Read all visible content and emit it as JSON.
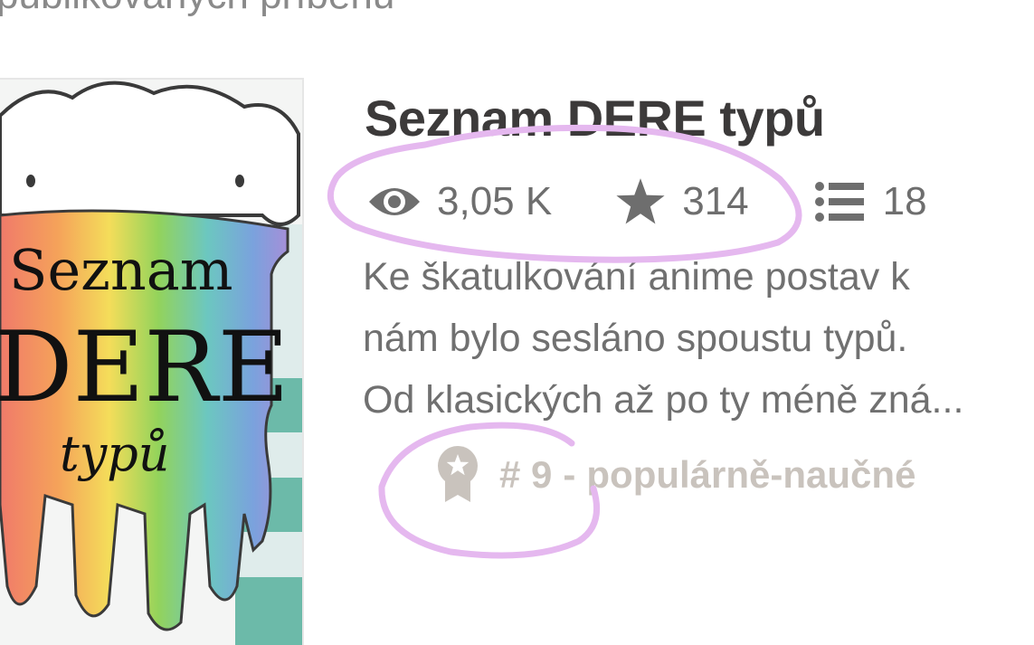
{
  "header": {
    "cut_text": "publikovaných příběhů"
  },
  "story": {
    "title": "Seznam DERE typů",
    "cover": {
      "line1": "Seznam",
      "line2": "DERE",
      "line3": "typů"
    },
    "stats": {
      "reads": "3,05 K",
      "votes": "314",
      "parts": "18",
      "reads_icon": "eye-icon",
      "votes_icon": "star-icon",
      "parts_icon": "list-icon"
    },
    "description": {
      "line1": "Ke škatulkování anime postav k",
      "line2": "nám bylo sesláno spoustu typů.",
      "line3": "Od klasických až po ty méně zná..."
    },
    "ranking": {
      "rank": "# 9",
      "separator": "-",
      "category": "populárně-naučné",
      "icon": "award-ribbon-icon"
    }
  },
  "colors": {
    "title": "#3c3a3a",
    "stats": "#6e6e6e",
    "description": "#707070",
    "ranking": "#c9c3bd",
    "annotation": "#e5b8ef"
  }
}
